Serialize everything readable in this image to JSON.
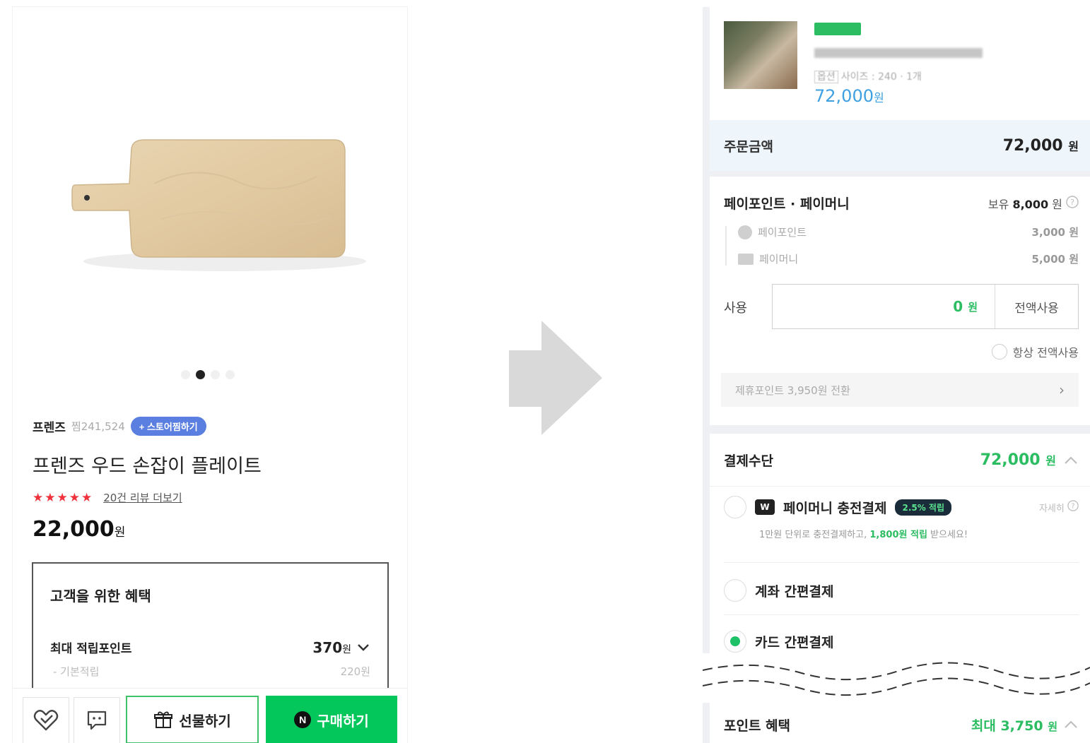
{
  "product": {
    "brand": "프렌즈",
    "brand_count": "찜241,524",
    "follow_label": "+ 스토어찜하기",
    "title": "프렌즈 우드 손잡이 플레이트",
    "stars": "★★★★★",
    "review_link": "20건 리뷰 더보기",
    "price": "22,000",
    "currency": "원",
    "image_dot_count": 4,
    "active_dot": 1
  },
  "benefit": {
    "title": "고객을 위한 혜택",
    "max_point_label": "최대 적립포인트",
    "max_point_value": "370",
    "base_label": "- 기본적립",
    "base_value": "220원"
  },
  "actions": {
    "gift_label": "선물하기",
    "buy_label": "구매하기",
    "buy_badge": "N"
  },
  "order": {
    "item_price": "72,000",
    "currency": "원",
    "option_tag": "옵션",
    "option_text": "사이즈 : 240 · 1개",
    "total_label": "주문금액",
    "total_value": "72,000"
  },
  "paypoint": {
    "title": "페이포인트 · 페이머니",
    "hold_prefix": "보유",
    "hold_value": "8,000",
    "point_label": "페이포인트",
    "point_value": "3,000 원",
    "money_label": "페이머니",
    "money_value": "5,000 원",
    "use_label": "사용",
    "use_value": "0",
    "use_all_label": "전액사용",
    "always_label": "항상 전액사용",
    "convert_label": "제휴포인트 3,950원 전환",
    "convert_chevron": "›"
  },
  "payment": {
    "title": "결제수단",
    "total": "72,000",
    "methods": [
      {
        "label": "페이머니 충전결제",
        "badge": "2.5% 적립",
        "detail": "자세히",
        "icon": "W"
      },
      {
        "label": "계좌 간편결제"
      },
      {
        "label": "카드 간편결제"
      }
    ],
    "desc_prefix": "1만원 단위로 충전결제하고, ",
    "desc_highlight": "1,800원 적립",
    "desc_suffix": " 받으세요!"
  },
  "points_benefit": {
    "title": "포인트 혜택",
    "value": "최대 3,750"
  },
  "colors": {
    "naver_green": "#03c75a",
    "point_green": "#2cbd62",
    "star_red": "#f0313b",
    "follow_blue": "#5a7fe0",
    "price_blue": "#3ea0e0"
  }
}
